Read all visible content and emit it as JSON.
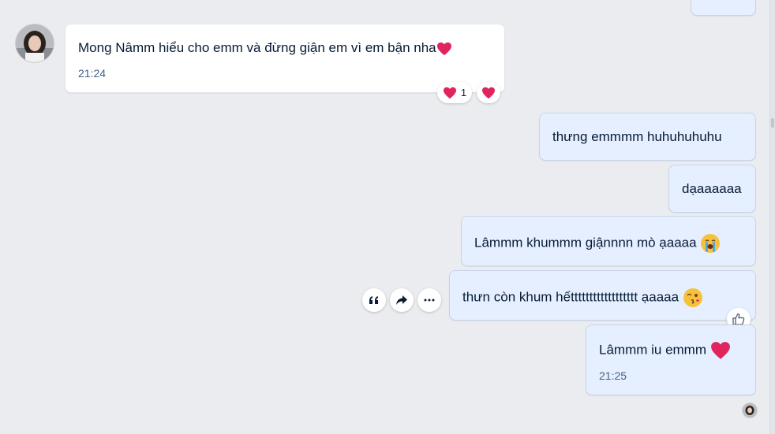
{
  "messages": [
    {
      "text": "Mong Nâmm hiểu cho emm và đừng giận em vì em bận nha",
      "emoji": "heart",
      "time": "21:24"
    },
    {
      "text": "thưng emmmm huhuhuhuhu"
    },
    {
      "text": "dạaaaaaa"
    },
    {
      "text": "Lâmmm khummm giậnnnn mò ạaaaa",
      "emoji": "crying-face"
    },
    {
      "text": "thưn còn khum hếtttttttttttttttttt ạaaaa",
      "emoji": "kissing-face"
    },
    {
      "text": "Lâmmm iu emmm",
      "emoji": "heart",
      "time": "21:25"
    }
  ],
  "reactions": {
    "heart_count": "1"
  },
  "icons": {
    "quote": "quote-icon",
    "share": "share-icon",
    "more": "more-icon",
    "like": "thumbs-up-icon"
  },
  "colors": {
    "background": "#ebecf0",
    "outgoing_bubble": "#e5efff",
    "incoming_bubble": "#ffffff",
    "text": "#081c36",
    "time": "#476285",
    "heart": "#e0245e"
  }
}
